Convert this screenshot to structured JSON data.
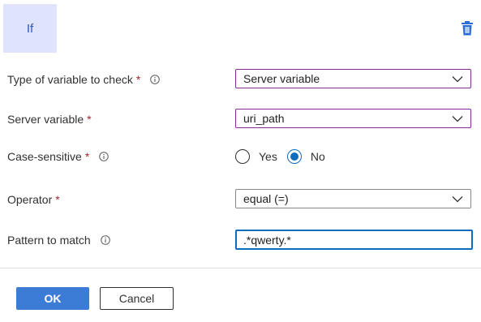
{
  "condition": {
    "keyword": "If"
  },
  "fields": {
    "variable_type": {
      "label": "Type of variable to check",
      "required_mark": "*",
      "value": "Server variable"
    },
    "server_variable": {
      "label": "Server variable",
      "required_mark": "*",
      "value": "uri_path"
    },
    "case_sensitive": {
      "label": "Case-sensitive",
      "required_mark": "*",
      "options": [
        "Yes",
        "No"
      ],
      "selected": "No"
    },
    "operator": {
      "label": "Operator",
      "required_mark": "*",
      "value": "equal (=)"
    },
    "pattern": {
      "label": "Pattern to match",
      "value": ".*qwerty.*"
    }
  },
  "buttons": {
    "ok": "OK",
    "cancel": "Cancel"
  },
  "icons": {
    "delete": "trash-icon",
    "info": "info-icon",
    "dropdown": "chevron-down-icon"
  },
  "colors": {
    "accent": "#0f6cbd",
    "primary_button": "#3c7bd6",
    "required": "#a4262c",
    "if_block_bg": "#dfe3fb",
    "if_block_text": "#2b56c6",
    "select_border": "#8a2a9a"
  }
}
